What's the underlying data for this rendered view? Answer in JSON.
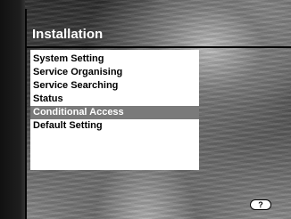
{
  "screen": {
    "title": "Installation"
  },
  "menu": {
    "items": [
      {
        "label": "System Setting"
      },
      {
        "label": "Service Organising"
      },
      {
        "label": "Service Searching"
      },
      {
        "label": "Status"
      },
      {
        "label": "Conditional Access",
        "selected": true
      },
      {
        "label": "Default Setting"
      }
    ]
  },
  "help_button": {
    "label": "?"
  },
  "colors": {
    "selected_bg": "#7a7a7a",
    "panel_bg": "#ffffff"
  }
}
